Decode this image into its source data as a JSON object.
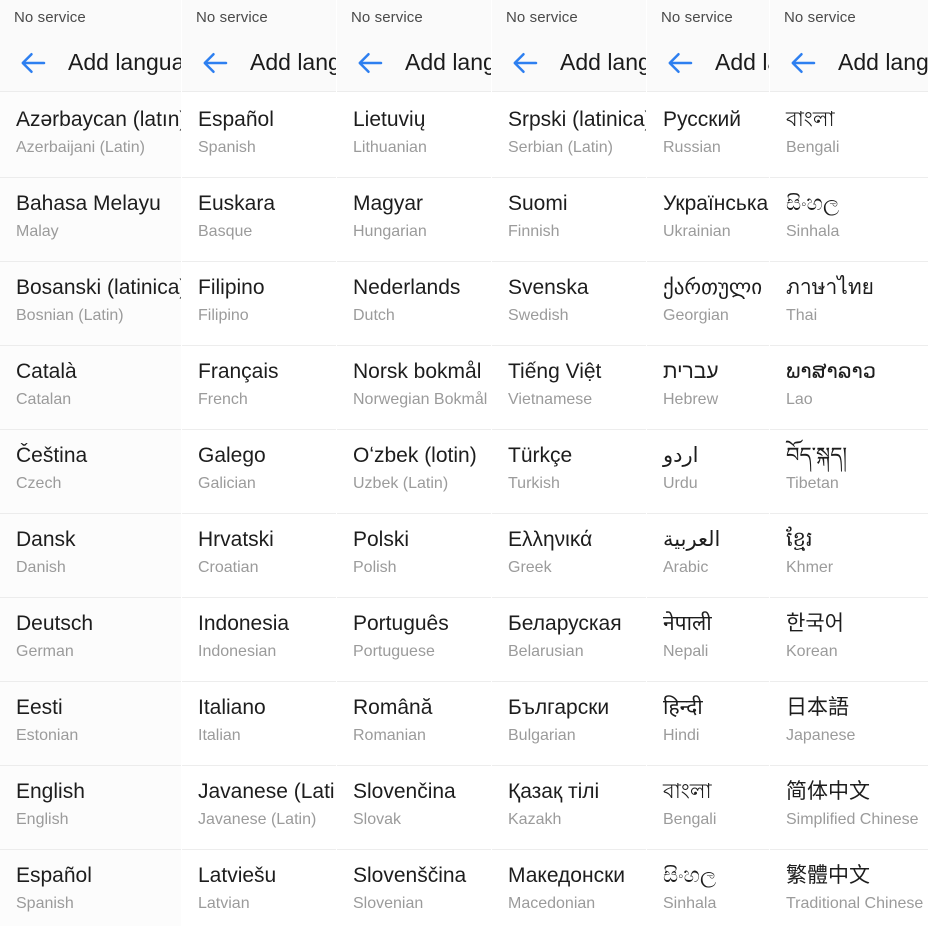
{
  "app": {
    "status_text": "No service",
    "screen_title": "Add language",
    "back_icon": "arrow-left-icon",
    "accent_color": "#2d7ff0",
    "title_color": "#1b1b1b",
    "native_color": "#1d1d1d",
    "english_color": "#9b9b9b",
    "divider_color": "#ededed"
  },
  "screens": [
    {
      "id": "screen-1",
      "status_text": "No service",
      "title": "Add language",
      "languages": [
        {
          "native": "Azərbaycan (latın)",
          "english": "Azerbaijani (Latin)"
        },
        {
          "native": "Bahasa Melayu",
          "english": "Malay"
        },
        {
          "native": "Bosanski (latinica)",
          "english": "Bosnian (Latin)"
        },
        {
          "native": "Català",
          "english": "Catalan"
        },
        {
          "native": "Čeština",
          "english": "Czech"
        },
        {
          "native": "Dansk",
          "english": "Danish"
        },
        {
          "native": "Deutsch",
          "english": "German"
        },
        {
          "native": "Eesti",
          "english": "Estonian"
        },
        {
          "native": "English",
          "english": "English"
        },
        {
          "native": "Español",
          "english": "Spanish"
        }
      ]
    },
    {
      "id": "screen-2",
      "status_text": "No service",
      "title": "Add language",
      "languages": [
        {
          "native": "Español",
          "english": "Spanish"
        },
        {
          "native": "Euskara",
          "english": "Basque"
        },
        {
          "native": "Filipino",
          "english": "Filipino"
        },
        {
          "native": "Français",
          "english": "French"
        },
        {
          "native": "Galego",
          "english": "Galician"
        },
        {
          "native": "Hrvatski",
          "english": "Croatian"
        },
        {
          "native": "Indonesia",
          "english": "Indonesian"
        },
        {
          "native": "Italiano",
          "english": "Italian"
        },
        {
          "native": "Javanese (Latin)",
          "english": "Javanese (Latin)"
        },
        {
          "native": "Latviešu",
          "english": "Latvian"
        }
      ]
    },
    {
      "id": "screen-3",
      "status_text": "No service",
      "title": "Add language",
      "languages": [
        {
          "native": "Lietuvių",
          "english": "Lithuanian"
        },
        {
          "native": "Magyar",
          "english": "Hungarian"
        },
        {
          "native": "Nederlands",
          "english": "Dutch"
        },
        {
          "native": "Norsk bokmål",
          "english": "Norwegian Bokmål"
        },
        {
          "native": "Oʻzbek (lotin)",
          "english": "Uzbek (Latin)"
        },
        {
          "native": "Polski",
          "english": "Polish"
        },
        {
          "native": "Português",
          "english": "Portuguese"
        },
        {
          "native": "Română",
          "english": "Romanian"
        },
        {
          "native": "Slovenčina",
          "english": "Slovak"
        },
        {
          "native": "Slovenščina",
          "english": "Slovenian"
        }
      ]
    },
    {
      "id": "screen-4",
      "status_text": "No service",
      "title": "Add language",
      "languages": [
        {
          "native": "Srpski (latinica)",
          "english": "Serbian (Latin)"
        },
        {
          "native": "Suomi",
          "english": "Finnish"
        },
        {
          "native": "Svenska",
          "english": "Swedish"
        },
        {
          "native": "Tiếng Việt",
          "english": "Vietnamese"
        },
        {
          "native": "Türkçe",
          "english": "Turkish"
        },
        {
          "native": "Ελληνικά",
          "english": "Greek"
        },
        {
          "native": "Беларуская",
          "english": "Belarusian"
        },
        {
          "native": "Български",
          "english": "Bulgarian"
        },
        {
          "native": "Қазақ тілі",
          "english": "Kazakh"
        },
        {
          "native": "Македонски",
          "english": "Macedonian"
        }
      ]
    },
    {
      "id": "screen-5",
      "status_text": "No service",
      "title": "Add language",
      "languages": [
        {
          "native": "Русский",
          "english": "Russian"
        },
        {
          "native": "Українська",
          "english": "Ukrainian"
        },
        {
          "native": "ქართული",
          "english": "Georgian"
        },
        {
          "native": "עברית",
          "english": "Hebrew"
        },
        {
          "native": "اردو",
          "english": "Urdu"
        },
        {
          "native": "العربية",
          "english": "Arabic"
        },
        {
          "native": "नेपाली",
          "english": "Nepali"
        },
        {
          "native": "हिन्दी",
          "english": "Hindi"
        },
        {
          "native": "বাংলা",
          "english": "Bengali"
        },
        {
          "native": "සිංහල",
          "english": "Sinhala"
        }
      ]
    },
    {
      "id": "screen-6",
      "status_text": "No service",
      "title": "Add language",
      "languages": [
        {
          "native": "বাংলা",
          "english": "Bengali"
        },
        {
          "native": "සිංහල",
          "english": "Sinhala"
        },
        {
          "native": "ภาษาไทย",
          "english": "Thai"
        },
        {
          "native": "ພາສາລາວ",
          "english": "Lao"
        },
        {
          "native": "བོད་སྐད།",
          "english": "Tibetan"
        },
        {
          "native": "ខ្មែរ",
          "english": "Khmer"
        },
        {
          "native": "한국어",
          "english": "Korean"
        },
        {
          "native": "日本語",
          "english": "Japanese"
        },
        {
          "native": "简体中文",
          "english": "Simplified Chinese"
        },
        {
          "native": "繁體中文",
          "english": "Traditional Chinese"
        }
      ]
    }
  ]
}
